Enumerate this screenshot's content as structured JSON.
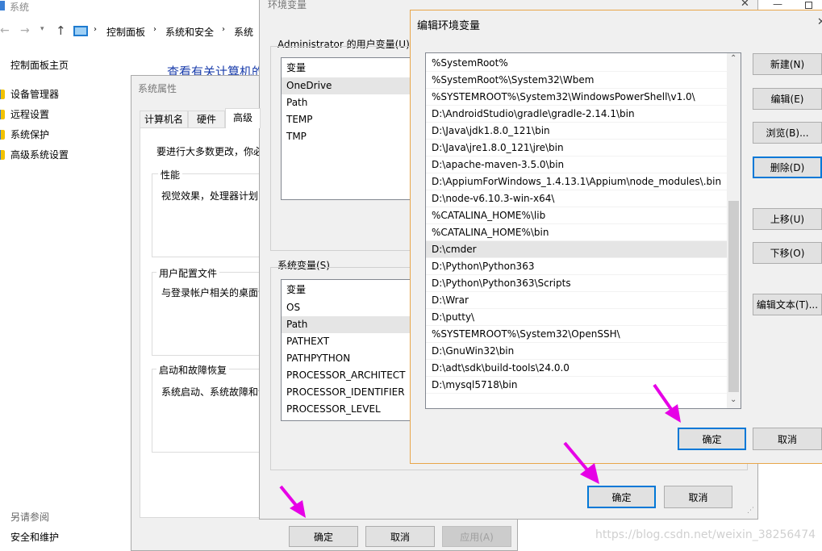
{
  "system_window": {
    "title": "系统",
    "breadcrumb": [
      "控制面板",
      "系统和安全",
      "系统"
    ],
    "left_nav": {
      "home": "控制面板主页",
      "items": [
        "设备管理器",
        "远程设置",
        "系统保护",
        "高级系统设置"
      ],
      "see_also": "另请参阅",
      "see_also_link": "安全和维护"
    },
    "heading": "查看有关计算机的"
  },
  "sys_props": {
    "title": "系统属性",
    "tabs": [
      "计算机名",
      "硬件",
      "高级"
    ],
    "admin_note": "要进行大多数更改，你必",
    "performance": {
      "title": "性能",
      "text": "视觉效果，处理器计划，"
    },
    "user_profiles": {
      "title": "用户配置文件",
      "text": "与登录帐户相关的桌面设"
    },
    "startup": {
      "title": "启动和故障恢复",
      "text": "系统启动、系统故障和调"
    },
    "buttons": {
      "ok": "确定",
      "cancel": "取消",
      "apply": "应用(A)"
    }
  },
  "env_vars": {
    "title": "环境变量",
    "user_section": "Administrator 的用户变量(U)",
    "user_header": "变量",
    "user_vars": [
      "OneDrive",
      "Path",
      "TEMP",
      "TMP"
    ],
    "system_section": "系统变量(S)",
    "system_header": "变量",
    "system_vars": [
      "OS",
      "Path",
      "PATHEXT",
      "PATHPYTHON",
      "PROCESSOR_ARCHITECT",
      "PROCESSOR_IDENTIFIER",
      "PROCESSOR_LEVEL"
    ],
    "buttons": {
      "ok": "确定",
      "cancel": "取消"
    }
  },
  "edit_env": {
    "title": "编辑环境变量",
    "paths": [
      "%SystemRoot%",
      "%SystemRoot%\\System32\\Wbem",
      "%SYSTEMROOT%\\System32\\WindowsPowerShell\\v1.0\\",
      "D:\\AndroidStudio\\gradle\\gradle-2.14.1\\bin",
      "D:\\Java\\jdk1.8.0_121\\bin",
      "D:\\Java\\jre1.8.0_121\\jre\\bin",
      "D:\\apache-maven-3.5.0\\bin",
      "D:\\AppiumForWindows_1.4.13.1\\Appium\\node_modules\\.bin",
      "D:\\node-v6.10.3-win-x64\\",
      "%CATALINA_HOME%\\lib",
      "%CATALINA_HOME%\\bin",
      "D:\\cmder",
      "D:\\Python\\Python363",
      "D:\\Python\\Python363\\Scripts",
      "D:\\Wrar",
      "D:\\putty\\",
      "%SYSTEMROOT%\\System32\\OpenSSH\\",
      "D:\\GnuWin32\\bin",
      "D:\\adt\\sdk\\build-tools\\24.0.0",
      "D:\\mysql5718\\bin"
    ],
    "selected_path": "D:\\cmder",
    "buttons": {
      "new": "新建(N)",
      "edit": "编辑(E)",
      "browse": "浏览(B)...",
      "delete": "删除(D)",
      "up": "上移(U)",
      "down": "下移(O)",
      "edit_text": "编辑文本(T)...",
      "ok": "确定",
      "cancel": "取消"
    }
  },
  "watermark": "https://blog.csdn.net/weixin_38256474",
  "colors": {
    "accent": "#0078d7",
    "arrow": "#e600e6",
    "link": "#1a3dab",
    "dialog_bg": "#f0f0f0",
    "selection": "#e5e5e5"
  }
}
